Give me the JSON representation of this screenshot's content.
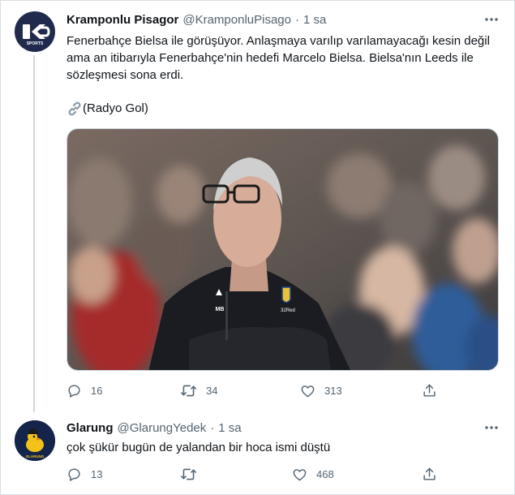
{
  "tweet1": {
    "display_name": "Kramponlu Pisagor",
    "handle": "@KramponluPisago",
    "dot": "·",
    "time": "1 sa",
    "avatar_text": "SPORTS",
    "text": "Fenerbahçe Bielsa ile görüşüyor. Anlaşmaya varılıp varılamayacağı kesin değil ama an itibarıyla Fenerbahçe'nin hedefi Marcelo Bielsa. Bielsa'nın Leeds ile sözleşmesi sona erdi.",
    "source_icon": "link-icon",
    "source": "(Radyo Gol)",
    "photo_jersey_text": "MB",
    "photo_sponsor_text": "32Red",
    "replies": "16",
    "retweets": "34",
    "likes": "313"
  },
  "tweet2": {
    "display_name": "Glarung",
    "handle": "@GlarungYedek",
    "dot": "·",
    "time": "1 sa",
    "avatar_text": "GLARUNG",
    "text": "çok şükür bugün de yalandan bir hoca ismi düştü",
    "replies": "13",
    "likes": "468"
  },
  "colors": {
    "text": "#0f1419",
    "secondary": "#536471",
    "border": "#cfd9de"
  }
}
